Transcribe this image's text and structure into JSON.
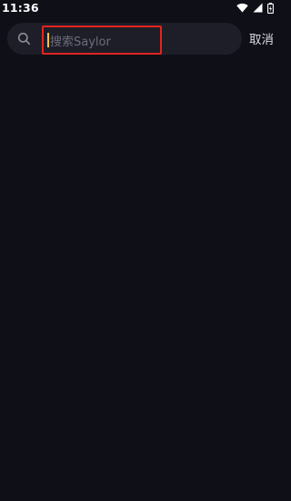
{
  "status_bar": {
    "time": "11:36",
    "icons": [
      "wifi-icon",
      "cellular-signal-icon",
      "battery-icon"
    ]
  },
  "search": {
    "placeholder": "搜索Saylor",
    "value": "",
    "cancel_label": "取消"
  },
  "colors": {
    "background": "#0f0f18",
    "search_box": "#1e1e29",
    "highlight_border": "#e3241e",
    "caret": "#f0c24b"
  }
}
